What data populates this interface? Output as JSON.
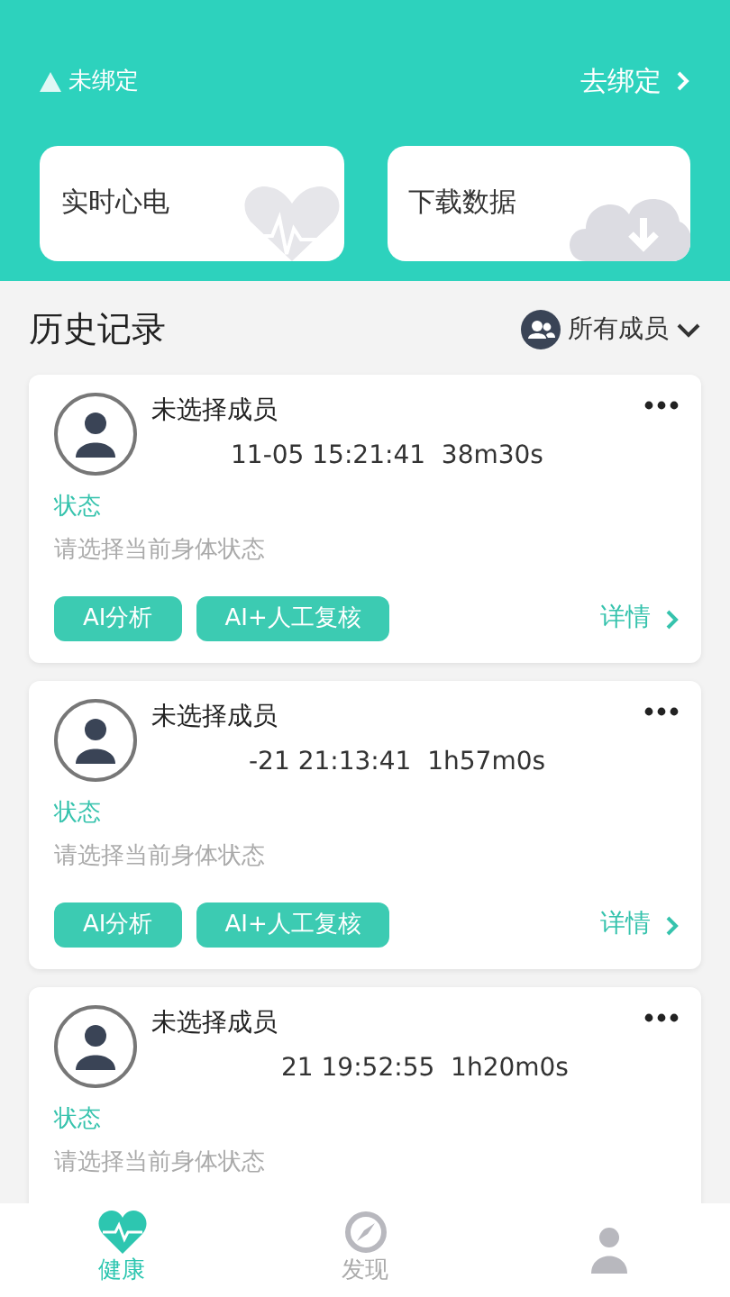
{
  "binding": {
    "status": "未绑定",
    "action": "去绑定"
  },
  "quick_cards": [
    {
      "label": "实时心电",
      "kind": "ecg"
    },
    {
      "label": "下载数据",
      "kind": "download"
    }
  ],
  "history": {
    "title": "历史记录",
    "filter": "所有成员",
    "records": [
      {
        "member": "未选择成员",
        "time": "11-05 15:21:41  38m30s",
        "status_label": "状态",
        "status_hint": "请选择当前身体状态",
        "buttons": [
          "AI分析",
          "AI+人工复核"
        ],
        "details": "详情"
      },
      {
        "member": "未选择成员",
        "time": "-21 21:13:41  1h57m0s",
        "status_label": "状态",
        "status_hint": "请选择当前身体状态",
        "buttons": [
          "AI分析",
          "AI+人工复核"
        ],
        "details": "详情"
      },
      {
        "member": "未选择成员",
        "time": "21 19:52:55  1h20m0s",
        "status_label": "状态",
        "status_hint": "请选择当前身体状态"
      }
    ]
  },
  "tabs": [
    {
      "label": "健康",
      "kind": "heart",
      "selected": true
    },
    {
      "label": "发现",
      "kind": "compass",
      "selected": false
    },
    {
      "kind": "person",
      "selected": false
    }
  ]
}
